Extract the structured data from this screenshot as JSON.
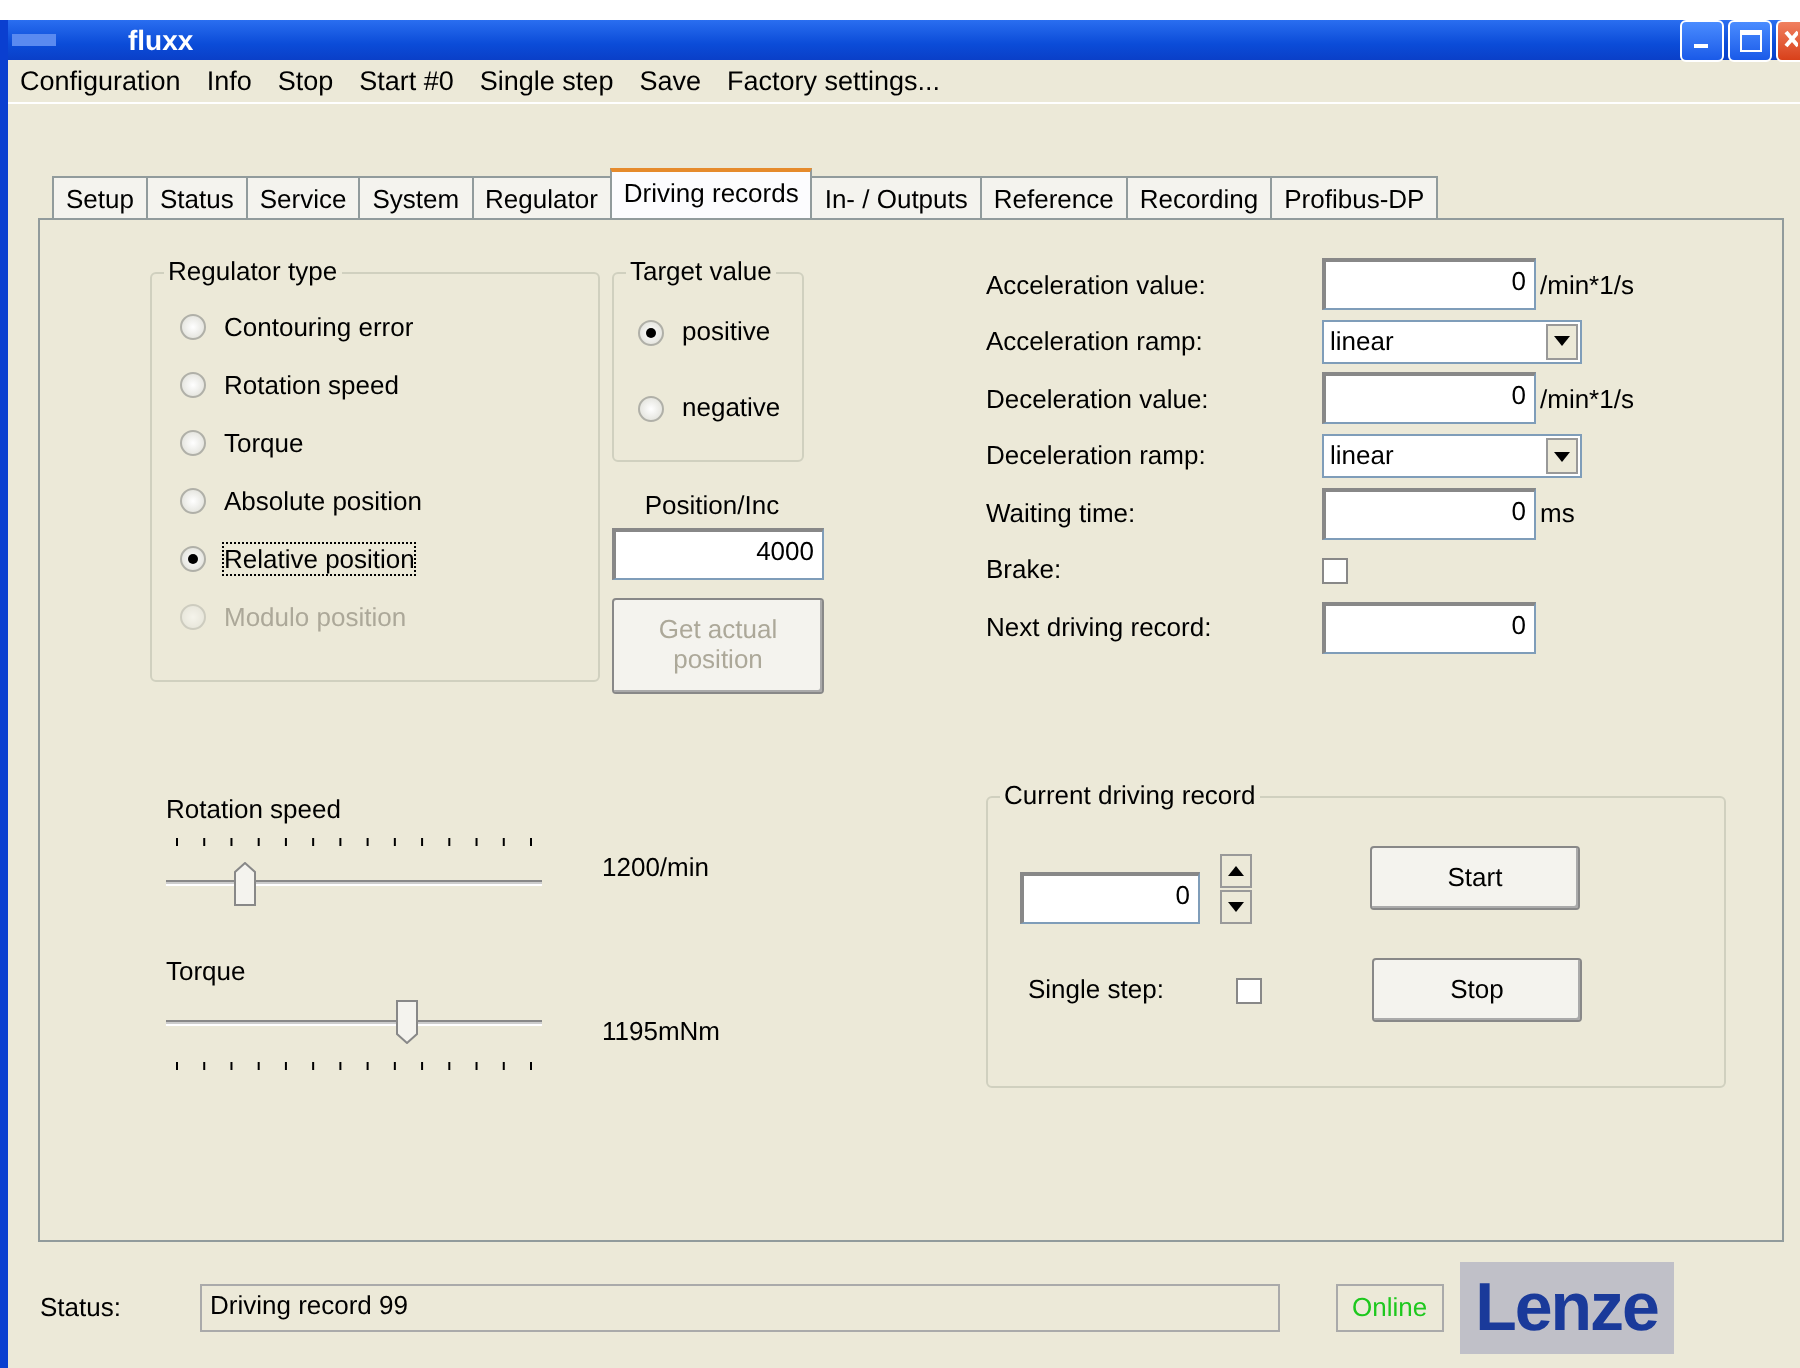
{
  "window": {
    "title": "fluxx"
  },
  "menu": [
    "Configuration",
    "Info",
    "Stop",
    "Start #0",
    "Single step",
    "Save",
    "Factory settings..."
  ],
  "tabs": [
    {
      "label": "Setup",
      "selected": false
    },
    {
      "label": "Status",
      "selected": false
    },
    {
      "label": "Service",
      "selected": false
    },
    {
      "label": "System",
      "selected": false
    },
    {
      "label": "Regulator",
      "selected": false
    },
    {
      "label": "Driving records",
      "selected": true
    },
    {
      "label": "In- / Outputs",
      "selected": false
    },
    {
      "label": "Reference",
      "selected": false
    },
    {
      "label": "Recording",
      "selected": false
    },
    {
      "label": "Profibus-DP",
      "selected": false
    }
  ],
  "regulator_type": {
    "title": "Regulator type",
    "options": [
      {
        "label": "Contouring error",
        "selected": false,
        "disabled": false,
        "focused": false
      },
      {
        "label": "Rotation speed",
        "selected": false,
        "disabled": false,
        "focused": false
      },
      {
        "label": "Torque",
        "selected": false,
        "disabled": false,
        "focused": false
      },
      {
        "label": "Absolute position",
        "selected": false,
        "disabled": false,
        "focused": false
      },
      {
        "label": "Relative position",
        "selected": true,
        "disabled": false,
        "focused": true
      },
      {
        "label": "Modulo position",
        "selected": false,
        "disabled": true,
        "focused": false
      }
    ]
  },
  "target_value": {
    "title": "Target value",
    "options": [
      {
        "label": "positive",
        "selected": true
      },
      {
        "label": "negative",
        "selected": false
      }
    ]
  },
  "position": {
    "label": "Position/Inc",
    "value": "4000"
  },
  "get_position_button": {
    "label": "Get actual position",
    "disabled": true
  },
  "parameters": [
    {
      "kind": "input",
      "label": "Acceleration value:",
      "value": "0",
      "unit": "/min*1/s"
    },
    {
      "kind": "select",
      "label": "Acceleration ramp:",
      "value": "linear"
    },
    {
      "kind": "input",
      "label": "Deceleration value:",
      "value": "0",
      "unit": "/min*1/s"
    },
    {
      "kind": "select",
      "label": "Deceleration ramp:",
      "value": "linear"
    },
    {
      "kind": "input",
      "label": "Waiting time:",
      "value": "0",
      "unit": "ms"
    },
    {
      "kind": "checkbox",
      "label": "Brake:",
      "checked": false
    },
    {
      "kind": "input",
      "label": "Next driving record:",
      "value": "0"
    }
  ],
  "sliders": [
    {
      "label": "Rotation speed",
      "level": 0.21,
      "reading": "1200/min",
      "kind": "ticks_top"
    },
    {
      "label": "Torque",
      "level": 0.64,
      "reading": "1195mNm",
      "kind": "ticks_bottom"
    }
  ],
  "current_record": {
    "title": "Current driving record",
    "value": "0",
    "single_step_label": "Single step:",
    "single_step_checked": false,
    "buttons": [
      "Start",
      "Stop"
    ]
  },
  "status_bar": {
    "label": "Status:",
    "message": "Driving record 99",
    "connection": "Online",
    "logo": "Lenze"
  }
}
